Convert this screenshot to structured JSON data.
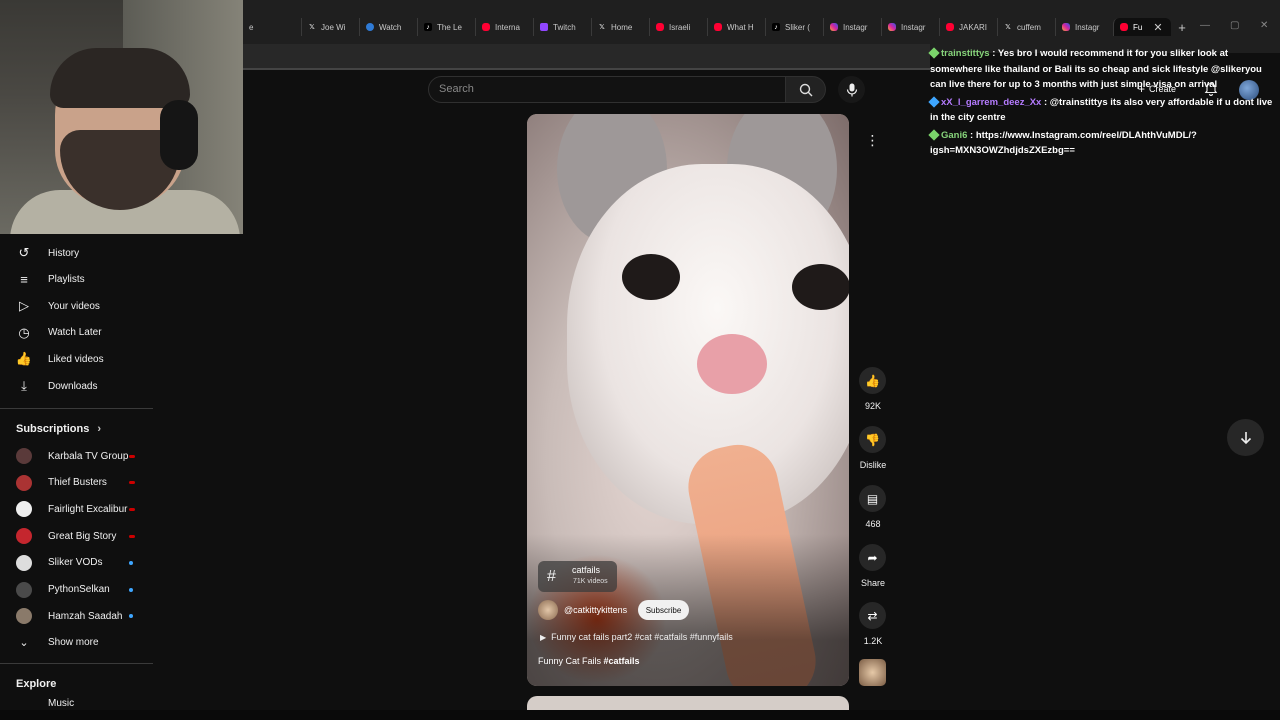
{
  "tabs": [
    {
      "label": "e",
      "icon": "none"
    },
    {
      "label": "Joe Wi",
      "icon": "x"
    },
    {
      "label": "Watch",
      "icon": "ed"
    },
    {
      "label": "The Le",
      "icon": "tt"
    },
    {
      "label": "Interna",
      "icon": "yt"
    },
    {
      "label": "Twitch",
      "icon": "tw"
    },
    {
      "label": "Home",
      "icon": "x"
    },
    {
      "label": "Israeli",
      "icon": "yt"
    },
    {
      "label": "What H",
      "icon": "yt"
    },
    {
      "label": "Sliker (",
      "icon": "tt"
    },
    {
      "label": "Instagr",
      "icon": "ig"
    },
    {
      "label": "Instagr",
      "icon": "ig"
    },
    {
      "label": "JAKARI",
      "icon": "yt"
    },
    {
      "label": "cuffem",
      "icon": "x"
    },
    {
      "label": "Instagr",
      "icon": "ig"
    },
    {
      "label": "Fu",
      "icon": "yt",
      "active": true
    }
  ],
  "sidebar": {
    "items": [
      {
        "label": "History",
        "icon": "history-icon",
        "glyph": "↺"
      },
      {
        "label": "Playlists",
        "icon": "playlist-icon",
        "glyph": "≡"
      },
      {
        "label": "Your videos",
        "icon": "your-videos-icon",
        "glyph": "▷"
      },
      {
        "label": "Watch Later",
        "icon": "clock-icon",
        "glyph": "◷"
      },
      {
        "label": "Liked videos",
        "icon": "thumbs-up-icon",
        "glyph": "👍"
      },
      {
        "label": "Downloads",
        "icon": "download-icon",
        "glyph": "⤓"
      }
    ],
    "subscriptions_title": "Subscriptions",
    "subscriptions": [
      {
        "label": "Karbala TV Group",
        "status": "live",
        "color": "#5a3a3a"
      },
      {
        "label": "Thief Busters",
        "status": "live",
        "color": "#a33"
      },
      {
        "label": "Fairlight Excalibur",
        "status": "live",
        "color": "#eee"
      },
      {
        "label": "Great Big Story",
        "status": "live",
        "color": "#c4262e"
      },
      {
        "label": "Sliker VODs",
        "status": "new",
        "color": "#ddd"
      },
      {
        "label": "PythonSelkan",
        "status": "new",
        "color": "#4a4a4a"
      },
      {
        "label": "Hamzah Saadah",
        "status": "new",
        "color": "#8a7a6a"
      }
    ],
    "show_more": "Show more",
    "explore_title": "Explore",
    "explore_first": "Music"
  },
  "search": {
    "placeholder": "Search"
  },
  "short": {
    "hashtag": "catfails",
    "hashtag_count": "71K videos",
    "channel": "@catkittykittens",
    "subscribe": "Subscribe",
    "music": "Funny cat fails part2 #cat #catfails #funnyfails",
    "caption_text": "Funny Cat Fails ",
    "caption_tag": "#catfails"
  },
  "actions": {
    "likes": "92K",
    "dislike": "Dislike",
    "comments": "468",
    "share": "Share",
    "remix": "1.2K"
  },
  "header": {
    "create": "Create"
  },
  "chat": [
    {
      "user": "trainstittys",
      "text": " : Yes bro I would recommend it for you sliker look at somewhere like thailand or Bali its so cheap and sick lifestyle @slikeryou can live there for up to 3 months with just simple visa on arrival"
    },
    {
      "user": "xX_l_garrem_deez_Xx",
      "text": " : @trainstittys its also very affordable if u dont live in the city centre"
    },
    {
      "user": "Gani6",
      "text": " : https://www.Instagram.com/reel/DLAhthVuMDL/?igsh=MXN3OWZhdjdsZXEzbg=="
    }
  ],
  "colors": {
    "accent": "#ff0033",
    "live": "#cc0000",
    "new": "#3ea6ff"
  }
}
